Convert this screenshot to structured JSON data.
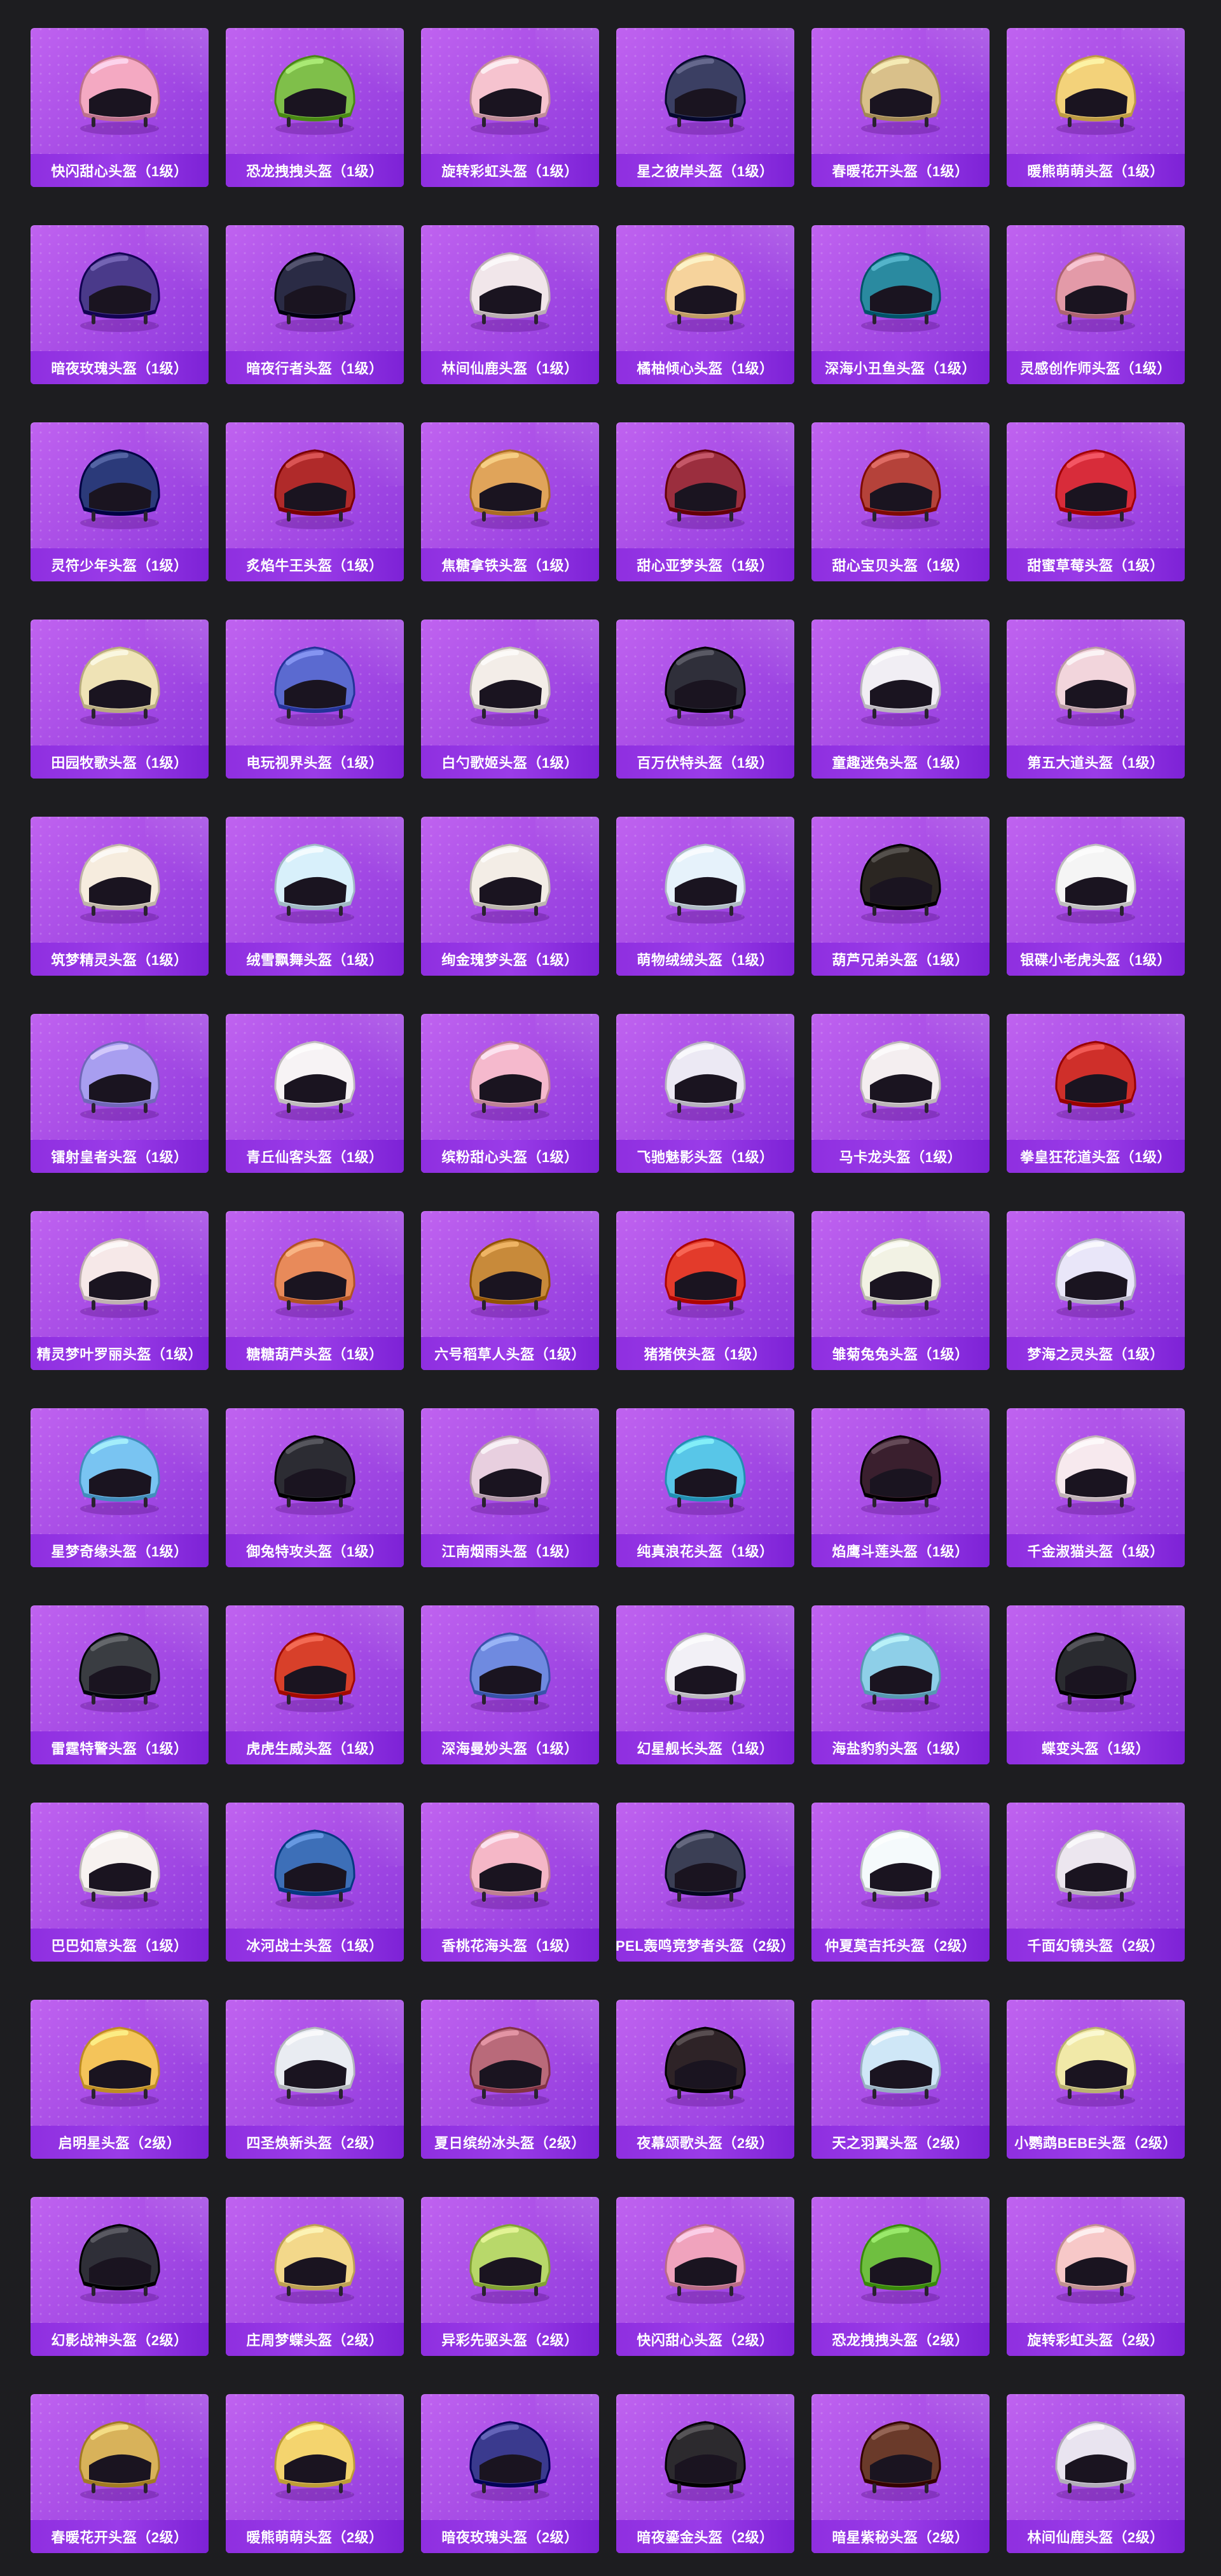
{
  "items": [
    {
      "label": "快闪甜心头盔（1级）",
      "color": "#f4a9c2"
    },
    {
      "label": "恐龙拽拽头盔（1级）",
      "color": "#7fbf4a"
    },
    {
      "label": "旋转彩虹头盔（1级）",
      "color": "#f6c3cf"
    },
    {
      "label": "星之彼岸头盔（1级）",
      "color": "#3b3f63"
    },
    {
      "label": "春暖花开头盔（1级）",
      "color": "#d9c08a"
    },
    {
      "label": "暖熊萌萌头盔（1级）",
      "color": "#f3d27a"
    },
    {
      "label": "暗夜玫瑰头盔（1级）",
      "color": "#4a3a8a"
    },
    {
      "label": "暗夜行者头盔（1级）",
      "color": "#2a2b45"
    },
    {
      "label": "林间仙鹿头盔（1级）",
      "color": "#f1e6ea"
    },
    {
      "label": "橘柚倾心头盔（1级）",
      "color": "#f6d39c"
    },
    {
      "label": "深海小丑鱼头盔（1级）",
      "color": "#2a8aa0"
    },
    {
      "label": "灵感创作师头盔（1级）",
      "color": "#e39aa8"
    },
    {
      "label": "灵符少年头盔（1级）",
      "color": "#2b3a7a"
    },
    {
      "label": "炙焰牛王头盔（1级）",
      "color": "#b02a2a"
    },
    {
      "label": "焦糖拿铁头盔（1级）",
      "color": "#e0a45a"
    },
    {
      "label": "甜心亚梦头盔（1级）",
      "color": "#9b2e3e"
    },
    {
      "label": "甜心宝贝头盔（1级）",
      "color": "#b5423a"
    },
    {
      "label": "甜蜜草莓头盔（1级）",
      "color": "#d82c3a"
    },
    {
      "label": "田园牧歌头盔（1级）",
      "color": "#efe3b6"
    },
    {
      "label": "电玩视界头盔（1级）",
      "color": "#5b6ad0"
    },
    {
      "label": "白勺歌姬头盔（1级）",
      "color": "#f3ede8"
    },
    {
      "label": "百万伏特头盔（1级）",
      "color": "#2f2f3a"
    },
    {
      "label": "童趣迷兔头盔（1级）",
      "color": "#f1eef4"
    },
    {
      "label": "第五大道头盔（1级）",
      "color": "#f2d5dc"
    },
    {
      "label": "筑梦精灵头盔（1级）",
      "color": "#f6ecde"
    },
    {
      "label": "绒雪飘舞头盔（1级）",
      "color": "#d8f0fb"
    },
    {
      "label": "绚金瑰梦头盔（1级）",
      "color": "#f3ede6"
    },
    {
      "label": "萌物绒绒头盔（1级）",
      "color": "#e6f2fb"
    },
    {
      "label": "葫芦兄弟头盔（1级）",
      "color": "#2b2622"
    },
    {
      "label": "银碟小老虎头盔（1级）",
      "color": "#f5f5f5"
    },
    {
      "label": "镭射皇者头盔（1级）",
      "color": "#a89ef0"
    },
    {
      "label": "青丘仙客头盔（1级）",
      "color": "#f7f3f5"
    },
    {
      "label": "缤粉甜心头盔（1级）",
      "color": "#f5b9cd"
    },
    {
      "label": "飞驰魅影头盔（1级）",
      "color": "#ece9f4"
    },
    {
      "label": "马卡龙头盔（1级）",
      "color": "#f4eef0"
    },
    {
      "label": "拳皇狂花道头盔（1级）",
      "color": "#cf2f2a"
    },
    {
      "label": "精灵梦叶罗丽头盔（1级）",
      "color": "#f6e8e8"
    },
    {
      "label": "糖糖葫芦头盔（1级）",
      "color": "#e88a5a"
    },
    {
      "label": "六号稻草人头盔（1级）",
      "color": "#c88a3a"
    },
    {
      "label": "猪猪侠头盔（1级）",
      "color": "#e33b2b"
    },
    {
      "label": "雏菊兔兔头盔（1级）",
      "color": "#f2f2e4"
    },
    {
      "label": "梦海之灵头盔（1级）",
      "color": "#e9e6f9"
    },
    {
      "label": "星梦奇缘头盔（1级）",
      "color": "#79c4f2"
    },
    {
      "label": "御兔特攻头盔（1级）",
      "color": "#2c2c33"
    },
    {
      "label": "江南烟雨头盔（1级）",
      "color": "#e8cfdf"
    },
    {
      "label": "纯真浪花头盔（1级）",
      "color": "#58c6e8"
    },
    {
      "label": "焰鹰斗莲头盔（1级）",
      "color": "#3a1f2e"
    },
    {
      "label": "千金淑猫头盔（1级）",
      "color": "#f7e9ee"
    },
    {
      "label": "雷霆特警头盔（1级）",
      "color": "#3a3d42"
    },
    {
      "label": "虎虎生威头盔（1级）",
      "color": "#d8402a"
    },
    {
      "label": "深海曼妙头盔（1级）",
      "color": "#6f8ae0"
    },
    {
      "label": "幻星舰长头盔（1级）",
      "color": "#f2f0f6"
    },
    {
      "label": "海盐豹豹头盔（1级）",
      "color": "#8ecfe8"
    },
    {
      "label": "蝶变头盔（1级）",
      "color": "#2a2b30"
    },
    {
      "label": "巴巴如意头盔（1级）",
      "color": "#f7f2f0"
    },
    {
      "label": "冰河战士头盔（1级）",
      "color": "#3d6fb8"
    },
    {
      "label": "香桃花海头盔（1级）",
      "color": "#f5b7c7"
    },
    {
      "label": "PEL轰鸣竞梦者头盔（2级）",
      "color": "#3b3f55"
    },
    {
      "label": "仲夏莫吉托头盔（2级）",
      "color": "#f5fafc"
    },
    {
      "label": "千面幻镜头盔（2级）",
      "color": "#ece6ef"
    },
    {
      "label": "启明星头盔（2级）",
      "color": "#f4c45a"
    },
    {
      "label": "四圣焕新头盔（2级）",
      "color": "#e9ecf2"
    },
    {
      "label": "夏日缤纷冰头盔（2级）",
      "color": "#b96a7a"
    },
    {
      "label": "夜幕颂歌头盔（2级）",
      "color": "#2e2327"
    },
    {
      "label": "天之羽翼头盔（2级）",
      "color": "#cfe7f7"
    },
    {
      "label": "小鹦鹉BEBE头盔（2级）",
      "color": "#f1e9a8"
    },
    {
      "label": "幻影战神头盔（2级）",
      "color": "#2f2f38"
    },
    {
      "label": "庄周梦蝶头盔（2级）",
      "color": "#f3d88a"
    },
    {
      "label": "异彩先驱头盔（2级）",
      "color": "#b8d86a"
    },
    {
      "label": "快闪甜心头盔（2级）",
      "color": "#f0a3bd"
    },
    {
      "label": "恐龙拽拽头盔（2级）",
      "color": "#6fbf40"
    },
    {
      "label": "旋转彩虹头盔（2级）",
      "color": "#f7c8c8"
    },
    {
      "label": "春暖花开头盔（2级）",
      "color": "#d8b25a"
    },
    {
      "label": "暖熊萌萌头盔（2级）",
      "color": "#f4d46e"
    },
    {
      "label": "暗夜玫瑰头盔（2级）",
      "color": "#3a3a8e"
    },
    {
      "label": "暗夜鎏金头盔（2级）",
      "color": "#2c2a2e"
    },
    {
      "label": "暗星紫秘头盔（2级）",
      "color": "#6a3a2a"
    },
    {
      "label": "林间仙鹿头盔（2级）",
      "color": "#e9e4f0"
    }
  ]
}
